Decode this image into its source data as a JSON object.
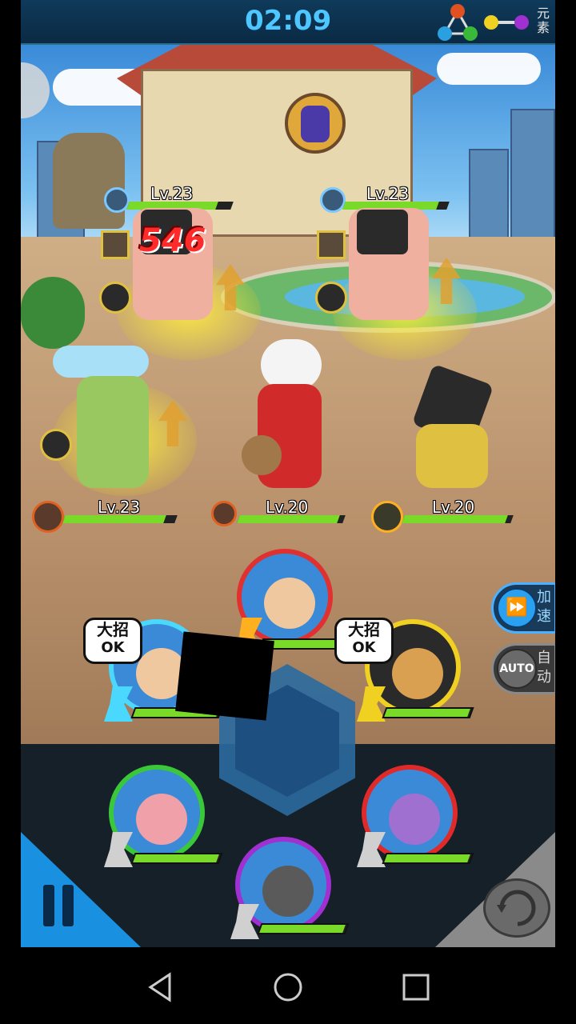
{
  "hud": {
    "timer": "02:09",
    "element_label": "元素"
  },
  "enemies": [
    {
      "level": "Lv.23",
      "hp": 0.85
    },
    {
      "level": "Lv.23",
      "hp": 0.9
    }
  ],
  "damage_number": "546",
  "allies": [
    {
      "level": "Lv.23",
      "hp": 0.9
    },
    {
      "level": "Lv.20",
      "hp": 0.95
    },
    {
      "level": "Lv.20",
      "hp": 0.95
    }
  ],
  "skills": {
    "ultimate_top": "大招",
    "ultimate_ok": "OK"
  },
  "controls": {
    "speed_icon": "fast-forward-icon",
    "speed_label": "加速",
    "auto_icon_text": "AUTO",
    "auto_label": "自动"
  },
  "colors": {
    "timer": "#4ec6ff",
    "hp_fill": "#7ada2a",
    "damage": "#ff2a2a"
  }
}
